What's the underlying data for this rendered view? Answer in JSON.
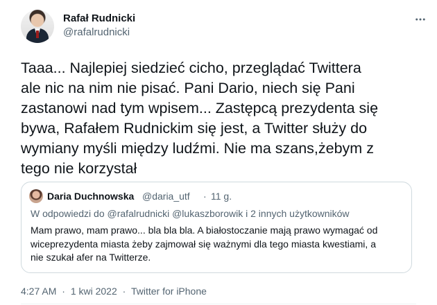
{
  "tweet": {
    "author": {
      "display_name": "Rafał Rudnicki",
      "handle": "@rafalrudnicki"
    },
    "text": "Taaa... Najlepiej siedzieć cicho, przeglądać Twittera\nale nic na nim nie pisać. Pani Dario, niech się Pani\nzastanowi nad tym wpisem... Zastępcą prezydenta się\nbywa, Rafałem Rudnickim się jest, a Twitter służy do\nwymiany myśli między ludźmi. Nie ma szans,żebym z\ntego nie korzystał",
    "quoted": {
      "display_name": "Daria Duchnowska",
      "handle": "@daria_utf",
      "separator": "·",
      "time": "11 g.",
      "reply_prefix": "W odpowiedzi do",
      "reply_handles": "@rafalrudnicki @lukaszborowik",
      "reply_suffix": "i 2 innych użytkowników",
      "text": "Mam prawo, mam prawo... bla bla bla. A białostoczanie mają prawo wymagać od\nwiceprezydenta miasta żeby zajmował się ważnymi dla tego miasta kwestiami, a\nnie szukał afer na Twitterze."
    },
    "meta": {
      "time": "4:27 AM",
      "separator1": "·",
      "date": "1 kwi 2022",
      "separator2": "·",
      "source": "Twitter for iPhone"
    }
  },
  "icons": {
    "more": "more-horizontal-icon"
  }
}
